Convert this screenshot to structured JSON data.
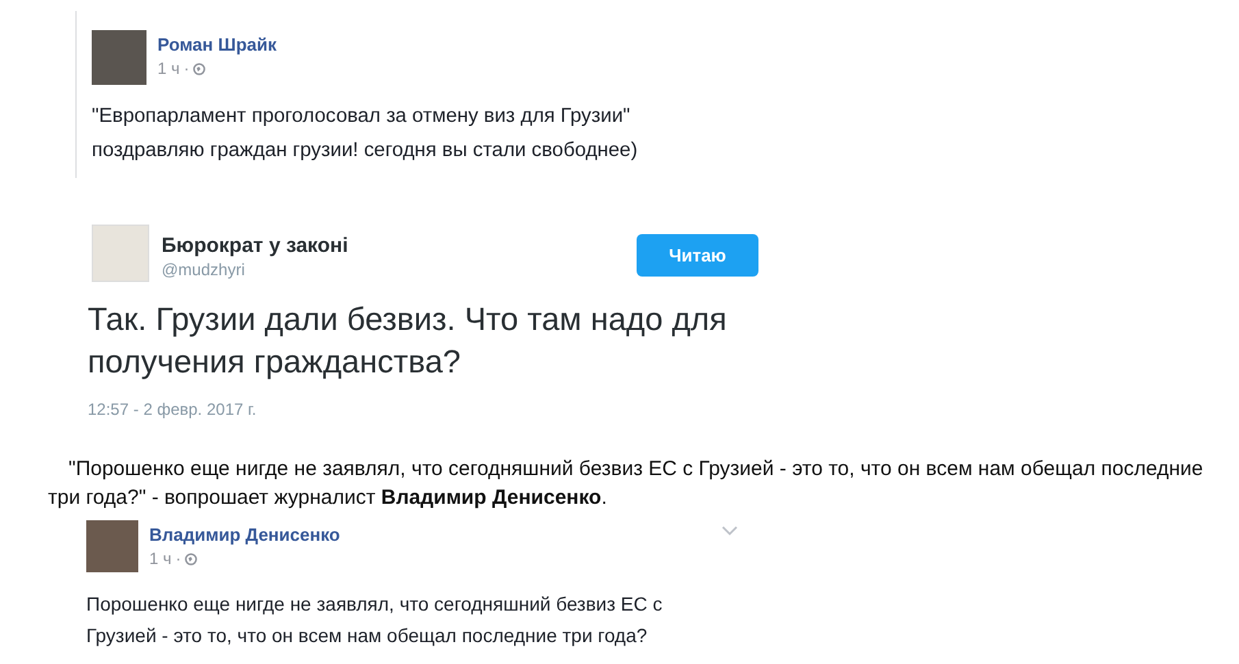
{
  "posts": [
    {
      "kind": "facebook",
      "author": "Роман Шрайк",
      "time": "1 ч",
      "separator": "·",
      "lines": [
        "\"Европарламент проголосовал за отмену виз для Грузии\"",
        "поздравляю граждан грузии! сегодня вы стали свободнее)"
      ],
      "menu": false,
      "border": true
    },
    {
      "kind": "tweet",
      "author": "Бюрократ у законі",
      "handle": "@mudzhyri",
      "button": "Читаю",
      "text": "Так. Грузии дали безвиз. Что там надо для получения гражданства?",
      "date": "12:57 - 2 февр. 2017 г."
    },
    {
      "kind": "paragraph",
      "text": "\"Порошенко еще нигде не заявлял, что сегодняшний безвиз ЕС с Грузией - это то, что он всем нам обещал последние три года?\" - вопрошает журналист **Владимир Денисенко**."
    },
    {
      "kind": "facebook",
      "author": "Владимир Денисенко",
      "time": "1 ч",
      "separator": "·",
      "lines": [
        "Порошенко еще нигде не заявлял, что сегодняшний безвиз ЕС с",
        "Грузией - это то, что он всем нам обещал последние три года?"
      ],
      "menu": true,
      "border": false
    }
  ]
}
